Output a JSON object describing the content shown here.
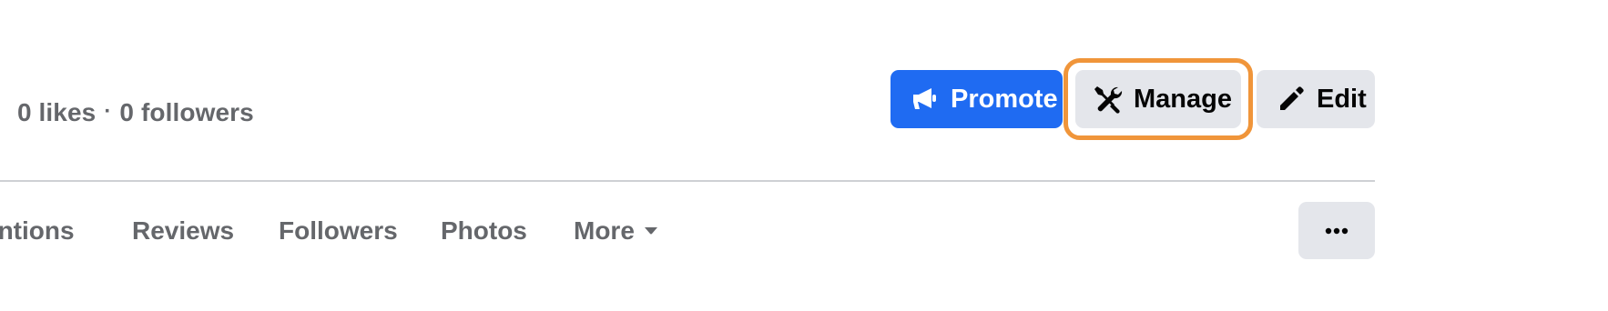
{
  "header": {
    "likes": "0 likes",
    "separator": "·",
    "followers": "0 followers"
  },
  "actions": {
    "promote_label": "Promote",
    "promote_icon": "megaphone-icon",
    "manage_label": "Manage",
    "manage_icon": "tools-icon",
    "edit_label": "Edit",
    "edit_icon": "pencil-icon"
  },
  "tabs": [
    {
      "label": "entions"
    },
    {
      "label": "Reviews"
    },
    {
      "label": "Followers"
    },
    {
      "label": "Photos"
    },
    {
      "label": "More"
    }
  ],
  "more_options_icon": "ellipsis-icon",
  "colors": {
    "primary_blue": "#1f6bf2",
    "highlight_orange": "#f0953a",
    "secondary_button_bg": "#e4e6eb",
    "muted_text": "#65676b",
    "divider": "#ced0d4"
  }
}
